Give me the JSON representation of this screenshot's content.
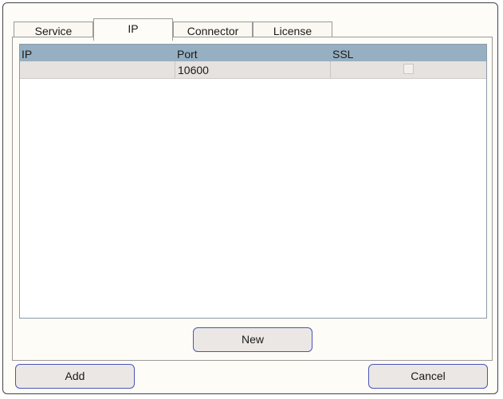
{
  "tabs": [
    {
      "label": "Service"
    },
    {
      "label": "IP"
    },
    {
      "label": "Connector"
    },
    {
      "label": "License"
    }
  ],
  "active_tab": "IP",
  "grid": {
    "columns": [
      {
        "label": "IP"
      },
      {
        "label": "Port"
      },
      {
        "label": "SSL"
      }
    ],
    "rows": [
      {
        "ip": "",
        "port": "10600",
        "ssl": false
      }
    ]
  },
  "panel": {
    "new_label": "New"
  },
  "footer": {
    "add_label": "Add",
    "cancel_label": "Cancel"
  }
}
